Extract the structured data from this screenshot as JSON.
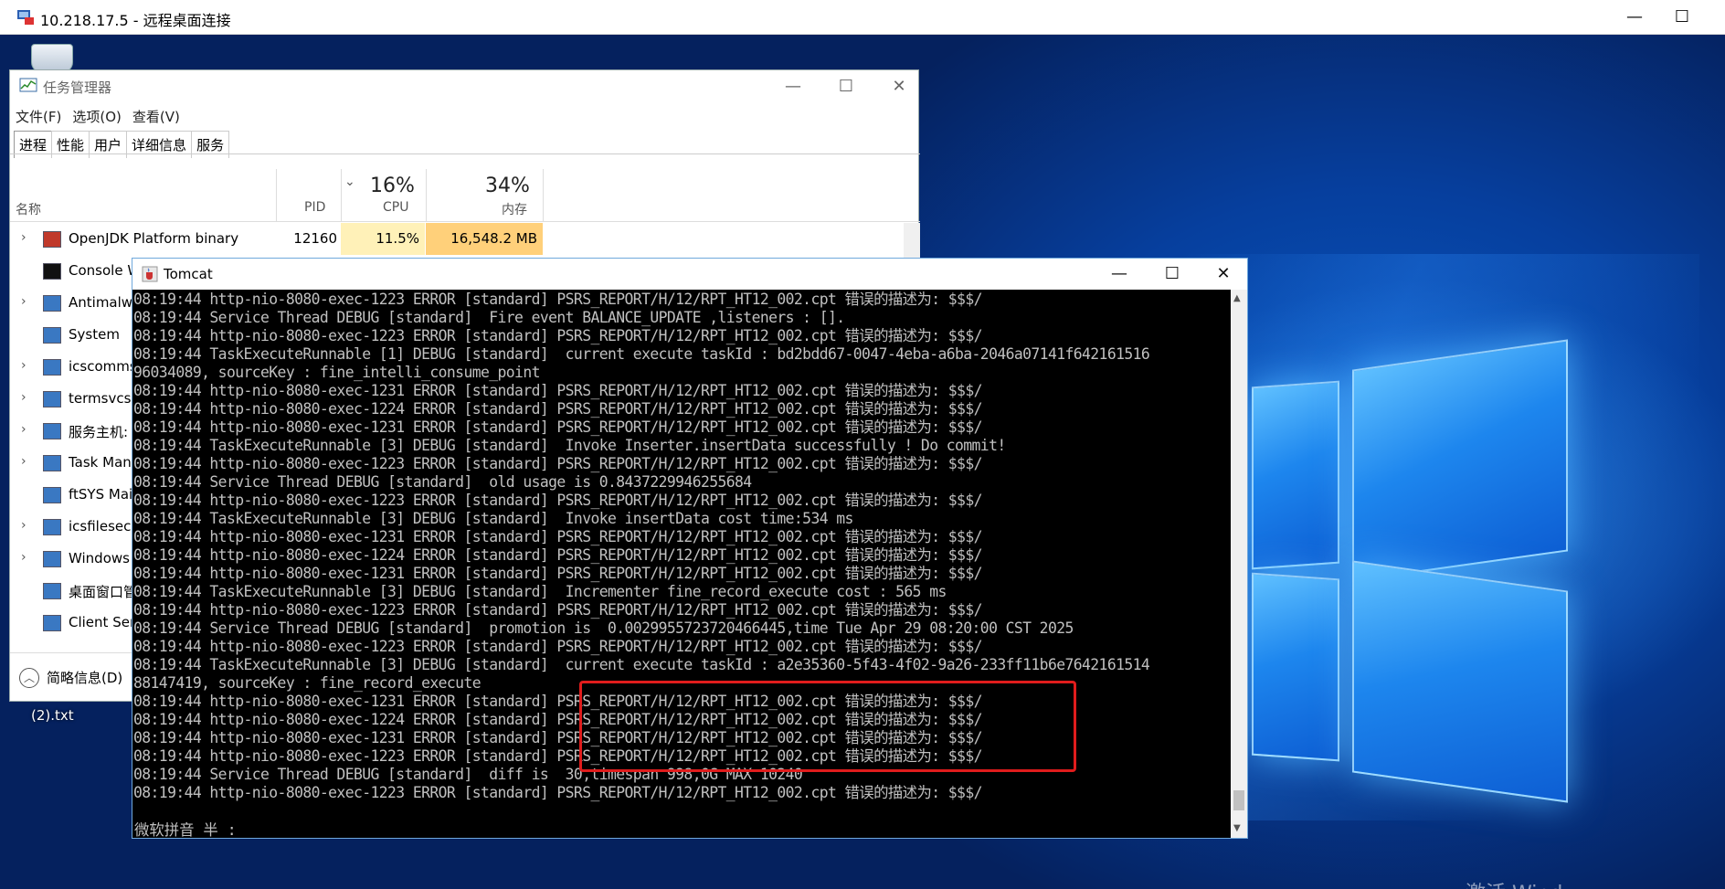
{
  "rdp": {
    "title": "10.218.17.5 - 远程桌面连接",
    "minimize": "—",
    "maximize": "☐"
  },
  "desktop": {
    "file_label": "(2).txt",
    "watermark": "激活 Wind"
  },
  "taskmgr": {
    "title": "任务管理器",
    "menu": [
      "文件(F)",
      "选项(O)",
      "查看(V)"
    ],
    "tabs": [
      "进程",
      "性能",
      "用户",
      "详细信息",
      "服务"
    ],
    "columns": {
      "name": "名称",
      "pid": "PID",
      "cpu_pct": "16%",
      "cpu": "CPU",
      "mem_pct": "34%",
      "mem": "内存"
    },
    "rows": [
      {
        "name": "OpenJDK Platform binary",
        "pid": "12160",
        "cpu": "11.5%",
        "mem": "16,548.2 MB",
        "expandable": true
      },
      {
        "name": "Console W",
        "expandable": false
      },
      {
        "name": "Antimalw",
        "expandable": true
      },
      {
        "name": "System",
        "expandable": false
      },
      {
        "name": "icscomms",
        "expandable": true
      },
      {
        "name": "termsvcs",
        "expandable": true
      },
      {
        "name": "服务主机:",
        "expandable": true
      },
      {
        "name": "Task Man",
        "expandable": true
      },
      {
        "name": "ftSYS Mai",
        "expandable": false
      },
      {
        "name": "icsfilesec.",
        "expandable": true
      },
      {
        "name": "Windows",
        "expandable": true
      },
      {
        "name": "桌面窗口管",
        "expandable": false
      },
      {
        "name": "Client Ser",
        "expandable": false
      }
    ],
    "footer": "简略信息(D)"
  },
  "tomcat": {
    "title": "Tomcat",
    "lines": [
      "08:19:44 http-nio-8080-exec-1223 ERROR [standard] PSRS_REPORT/H/12/RPT_HT12_002.cpt 错误的描述为: $$$/",
      "08:19:44 Service Thread DEBUG [standard]  Fire event BALANCE_UPDATE ,listeners : [].",
      "08:19:44 http-nio-8080-exec-1223 ERROR [standard] PSRS_REPORT/H/12/RPT_HT12_002.cpt 错误的描述为: $$$/",
      "08:19:44 TaskExecuteRunnable [1] DEBUG [standard]  current execute taskId : bd2bdd67-0047-4eba-a6ba-2046a07141f642161516",
      "96034089, sourceKey : fine_intelli_consume_point",
      "08:19:44 http-nio-8080-exec-1231 ERROR [standard] PSRS_REPORT/H/12/RPT_HT12_002.cpt 错误的描述为: $$$/",
      "08:19:44 http-nio-8080-exec-1224 ERROR [standard] PSRS_REPORT/H/12/RPT_HT12_002.cpt 错误的描述为: $$$/",
      "08:19:44 http-nio-8080-exec-1231 ERROR [standard] PSRS_REPORT/H/12/RPT_HT12_002.cpt 错误的描述为: $$$/",
      "08:19:44 TaskExecuteRunnable [3] DEBUG [standard]  Invoke Inserter.insertData successfully ! Do commit!",
      "08:19:44 http-nio-8080-exec-1223 ERROR [standard] PSRS_REPORT/H/12/RPT_HT12_002.cpt 错误的描述为: $$$/",
      "08:19:44 Service Thread DEBUG [standard]  old usage is 0.8437229946255684",
      "08:19:44 http-nio-8080-exec-1223 ERROR [standard] PSRS_REPORT/H/12/RPT_HT12_002.cpt 错误的描述为: $$$/",
      "08:19:44 TaskExecuteRunnable [3] DEBUG [standard]  Invoke insertData cost time:534 ms",
      "08:19:44 http-nio-8080-exec-1231 ERROR [standard] PSRS_REPORT/H/12/RPT_HT12_002.cpt 错误的描述为: $$$/",
      "08:19:44 http-nio-8080-exec-1224 ERROR [standard] PSRS_REPORT/H/12/RPT_HT12_002.cpt 错误的描述为: $$$/",
      "08:19:44 http-nio-8080-exec-1231 ERROR [standard] PSRS_REPORT/H/12/RPT_HT12_002.cpt 错误的描述为: $$$/",
      "08:19:44 TaskExecuteRunnable [3] DEBUG [standard]  Incrementer fine_record_execute cost : 565 ms",
      "08:19:44 http-nio-8080-exec-1223 ERROR [standard] PSRS_REPORT/H/12/RPT_HT12_002.cpt 错误的描述为: $$$/",
      "08:19:44 Service Thread DEBUG [standard]  promotion is  0.0029955723720466445,time Tue Apr 29 08:20:00 CST 2025",
      "08:19:44 http-nio-8080-exec-1223 ERROR [standard] PSRS_REPORT/H/12/RPT_HT12_002.cpt 错误的描述为: $$$/",
      "08:19:44 TaskExecuteRunnable [3] DEBUG [standard]  current execute taskId : a2e35360-5f43-4f02-9a26-233ff11b6e7642161514",
      "88147419, sourceKey : fine_record_execute",
      "08:19:44 http-nio-8080-exec-1231 ERROR [standard] PSRS_REPORT/H/12/RPT_HT12_002.cpt 错误的描述为: $$$/",
      "08:19:44 http-nio-8080-exec-1224 ERROR [standard] PSRS_REPORT/H/12/RPT_HT12_002.cpt 错误的描述为: $$$/",
      "08:19:44 http-nio-8080-exec-1231 ERROR [standard] PSRS_REPORT/H/12/RPT_HT12_002.cpt 错误的描述为: $$$/",
      "08:19:44 http-nio-8080-exec-1223 ERROR [standard] PSRS_REPORT/H/12/RPT_HT12_002.cpt 错误的描述为: $$$/",
      "08:19:44 Service Thread DEBUG [standard]  diff is  30,timespan 998,0G MAX 10240",
      "08:19:44 http-nio-8080-exec-1223 ERROR [standard] PSRS_REPORT/H/12/RPT_HT12_002.cpt 错误的描述为: $$$/"
    ],
    "ime": "微软拼音 半 :"
  },
  "colors": {
    "console_bg": "#000000",
    "console_text": "#c0c0c0",
    "highlight": "#e01c1c",
    "cpu_cell": "#fff1b8",
    "mem_cell": "#ffd07a"
  }
}
